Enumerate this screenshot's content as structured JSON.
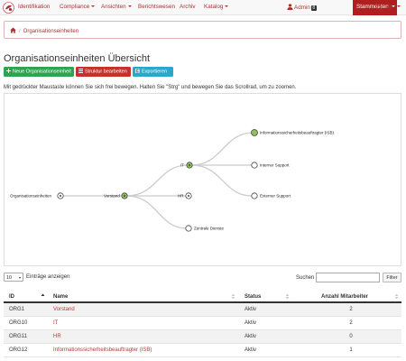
{
  "nav": {
    "items": [
      {
        "label": "Identifikation",
        "caret": false
      },
      {
        "label": "Compliance",
        "caret": true
      },
      {
        "label": "Ansichten",
        "caret": true
      },
      {
        "label": "Berichtswesen",
        "caret": false
      },
      {
        "label": "Archiv",
        "caret": false
      },
      {
        "label": "Katalog",
        "caret": true
      }
    ],
    "user": "Admin",
    "badge": "8",
    "active": "Stammdaten",
    "icons": [
      "search-icon",
      "gear-icon"
    ]
  },
  "breadcrumb": {
    "home_icon": "home-icon",
    "separator": "/",
    "current": "Organisationseinheiten"
  },
  "page": {
    "title": "Organisationseinheiten Übersicht",
    "buttons": {
      "new": "Neue Organisationseinheit",
      "edit": "Struktur bearbeiten",
      "export": "Exportieren"
    },
    "hint": "Mit gedrückter Maustaste können Sie sich frei bewegen. Halten Sie \"Strg\" und bewegen Sie das Scrollrad, um zu zoomen."
  },
  "tree": {
    "nodes": {
      "root": "Organisationseinheiten",
      "vorstand": "Vorstand",
      "it": "IT",
      "hr": "HR",
      "zentrale": "Zentrale Dienste",
      "isb": "Informationssicherheitsbeauftragter (ISB)",
      "interner": "Interner Support",
      "externer": "Externer Support"
    },
    "colors": {
      "expanded": "#8fbf5a",
      "link": "#cccccc"
    }
  },
  "controls": {
    "length_value": "10",
    "length_label": "Einträge anzeigen",
    "search_label": "Suchen",
    "search_value": "",
    "filter_label": "Filter"
  },
  "table": {
    "headers": {
      "id": "ID",
      "name": "Name",
      "status": "Status",
      "count": "Anzahl Mitarbeiter"
    },
    "rows": [
      {
        "id": "ORG1",
        "name": "Vorstand",
        "status": "Aktiv",
        "count": "2"
      },
      {
        "id": "ORG10",
        "name": "IT",
        "status": "Aktiv",
        "count": "2"
      },
      {
        "id": "ORG11",
        "name": "HR",
        "status": "Aktiv",
        "count": "0"
      },
      {
        "id": "ORG12",
        "name": "Informationssicherheitsbeauftragter (ISB)",
        "status": "Aktiv",
        "count": "1"
      }
    ]
  }
}
